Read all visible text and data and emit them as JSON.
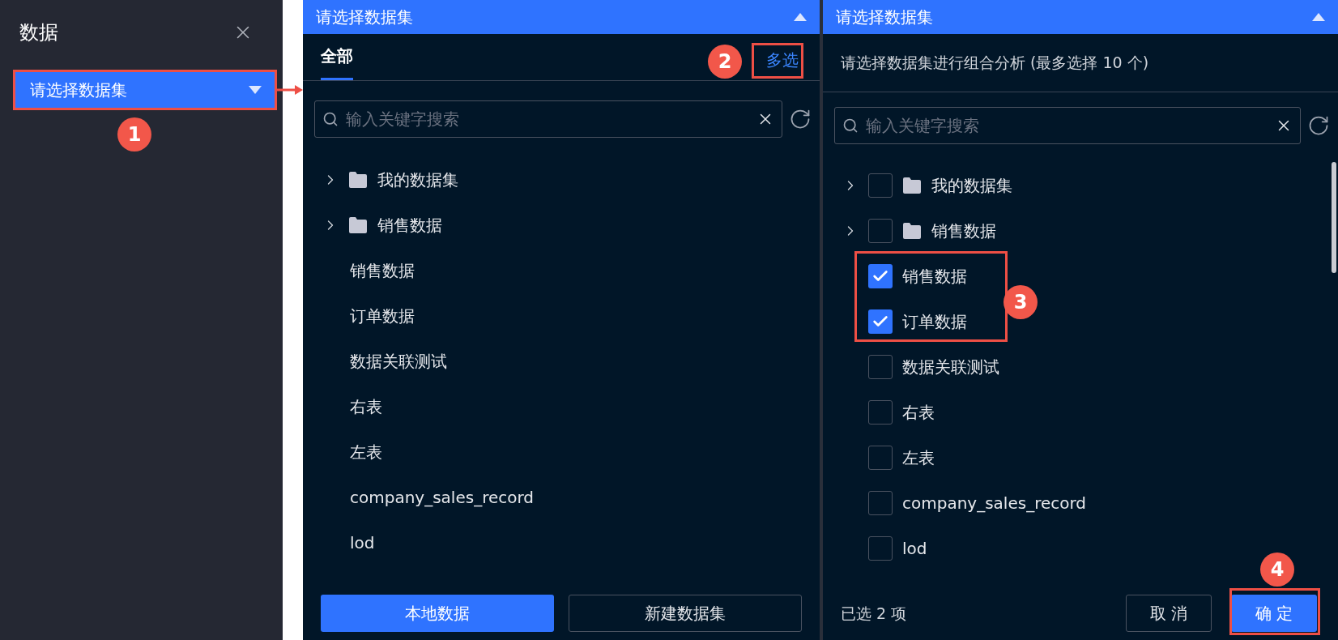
{
  "sidebar": {
    "title": "数据",
    "select": {
      "label": "请选择数据集"
    }
  },
  "single_panel": {
    "header": "请选择数据集",
    "tabs": [
      {
        "label": "全部",
        "selected": true
      }
    ],
    "multi_link": "多选",
    "search": {
      "placeholder": "输入关键字搜索"
    },
    "items": [
      {
        "kind": "folder",
        "label": "我的数据集",
        "expanded": false
      },
      {
        "kind": "folder",
        "label": "销售数据",
        "expanded": false
      },
      {
        "kind": "dataset",
        "label": "销售数据"
      },
      {
        "kind": "dataset",
        "label": "订单数据"
      },
      {
        "kind": "dataset",
        "label": "数据关联测试"
      },
      {
        "kind": "dataset",
        "label": "右表"
      },
      {
        "kind": "dataset",
        "label": "左表"
      },
      {
        "kind": "dataset",
        "label": "company_sales_record"
      },
      {
        "kind": "dataset",
        "label": "lod"
      }
    ],
    "buttons": [
      {
        "label": "本地数据",
        "kind": "primary"
      },
      {
        "label": "新建数据集",
        "kind": "secondary"
      }
    ]
  },
  "multi_panel": {
    "header": "请选择数据集",
    "hint": "请选择数据集进行组合分析 (最多选择 10 个)",
    "search": {
      "placeholder": "输入关键字搜索"
    },
    "items": [
      {
        "kind": "folder",
        "label": "我的数据集",
        "expanded": false,
        "checked": false
      },
      {
        "kind": "folder",
        "label": "销售数据",
        "expanded": false,
        "checked": false
      },
      {
        "kind": "dataset",
        "label": "销售数据",
        "checked": true
      },
      {
        "kind": "dataset",
        "label": "订单数据",
        "checked": true
      },
      {
        "kind": "dataset",
        "label": "数据关联测试",
        "checked": false
      },
      {
        "kind": "dataset",
        "label": "右表",
        "checked": false
      },
      {
        "kind": "dataset",
        "label": "左表",
        "checked": false
      },
      {
        "kind": "dataset",
        "label": "company_sales_record",
        "checked": false
      },
      {
        "kind": "dataset",
        "label": "lod",
        "checked": false
      }
    ],
    "selected_count": "已选 2 项",
    "buttons": [
      {
        "label": "取 消",
        "kind": "secondary"
      },
      {
        "label": "确 定",
        "kind": "primary"
      }
    ]
  },
  "annotations": [
    {
      "label": "1"
    },
    {
      "label": "2"
    },
    {
      "label": "3"
    },
    {
      "label": "4"
    }
  ]
}
